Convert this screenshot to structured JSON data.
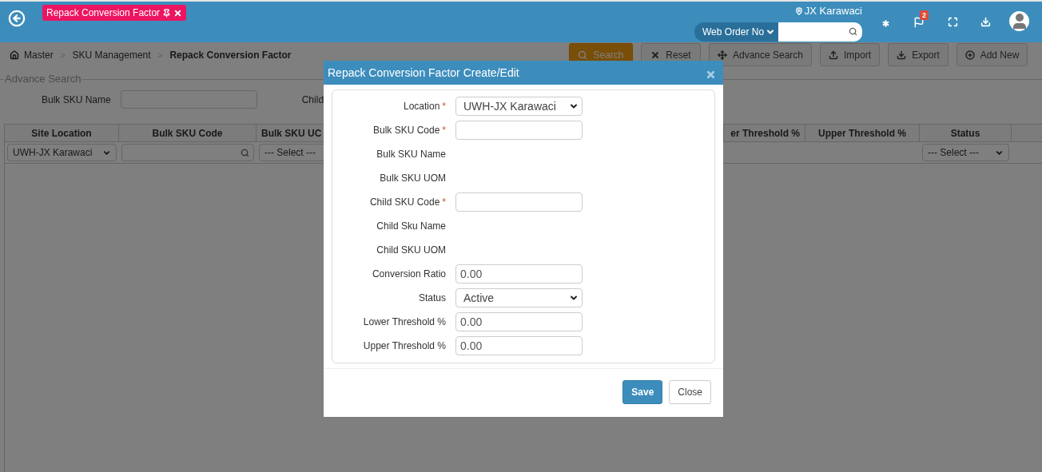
{
  "header": {
    "tab": {
      "label": "Repack Conversion Factor"
    },
    "location": "JX Karawaci",
    "search": {
      "scope": "Web Order No"
    },
    "notification_count": "2"
  },
  "breadcrumb": {
    "items": [
      "Master",
      "SKU Management",
      "Repack Conversion Factor"
    ],
    "separators": [
      ">",
      ">"
    ]
  },
  "toolbar": [
    {
      "kind": "search",
      "label": "Search"
    },
    {
      "kind": "reset",
      "label": "Reset"
    },
    {
      "kind": "advance",
      "label": "Advance Search"
    },
    {
      "kind": "import",
      "label": "Import"
    },
    {
      "kind": "export",
      "label": "Export"
    },
    {
      "kind": "add",
      "label": "Add New"
    }
  ],
  "advance_search": {
    "legend": "Advance Search",
    "field_label": "Bulk SKU Name",
    "next_label": "Child"
  },
  "table": {
    "columns": [
      {
        "label": "Site Location",
        "filter": {
          "kind": "select",
          "value": "UWH-JX Karawaci"
        }
      },
      {
        "label": "Bulk SKU Code",
        "filter": {
          "kind": "search"
        }
      },
      {
        "label": "Bulk SKU UC",
        "filter": {
          "kind": "select",
          "value": "--- Select ---"
        }
      },
      {
        "label": "er Threshold %"
      },
      {
        "label": "Upper Threshold %"
      },
      {
        "label": "Status",
        "filter": {
          "kind": "select",
          "value": "--- Select ---"
        }
      }
    ]
  },
  "modal": {
    "title": "Repack Conversion Factor Create/Edit",
    "fields": [
      {
        "label": "Location",
        "required_mark": "*",
        "kind": "select",
        "value": "UWH-JX Karawaci"
      },
      {
        "label": "Bulk SKU Code",
        "required_mark": "*",
        "kind": "input"
      },
      {
        "label": "Bulk SKU Name",
        "kind": "static"
      },
      {
        "label": "Bulk SKU UOM",
        "kind": "static"
      },
      {
        "label": "Child SKU Code",
        "required_mark": "*",
        "kind": "input"
      },
      {
        "label": "Child Sku Name",
        "kind": "static"
      },
      {
        "label": "Child SKU UOM",
        "kind": "static"
      },
      {
        "label": "Conversion Ratio",
        "kind": "input",
        "value": "0.00"
      },
      {
        "label": "Status",
        "kind": "select",
        "value": "Active"
      },
      {
        "label": "Lower Threshold %",
        "kind": "input",
        "value": "0.00"
      },
      {
        "label": "Upper Threshold %",
        "kind": "input",
        "value": "0.00"
      }
    ],
    "buttons": [
      {
        "kind": "primary",
        "label": "Save"
      },
      {
        "kind": "default",
        "label": "Close"
      }
    ]
  }
}
